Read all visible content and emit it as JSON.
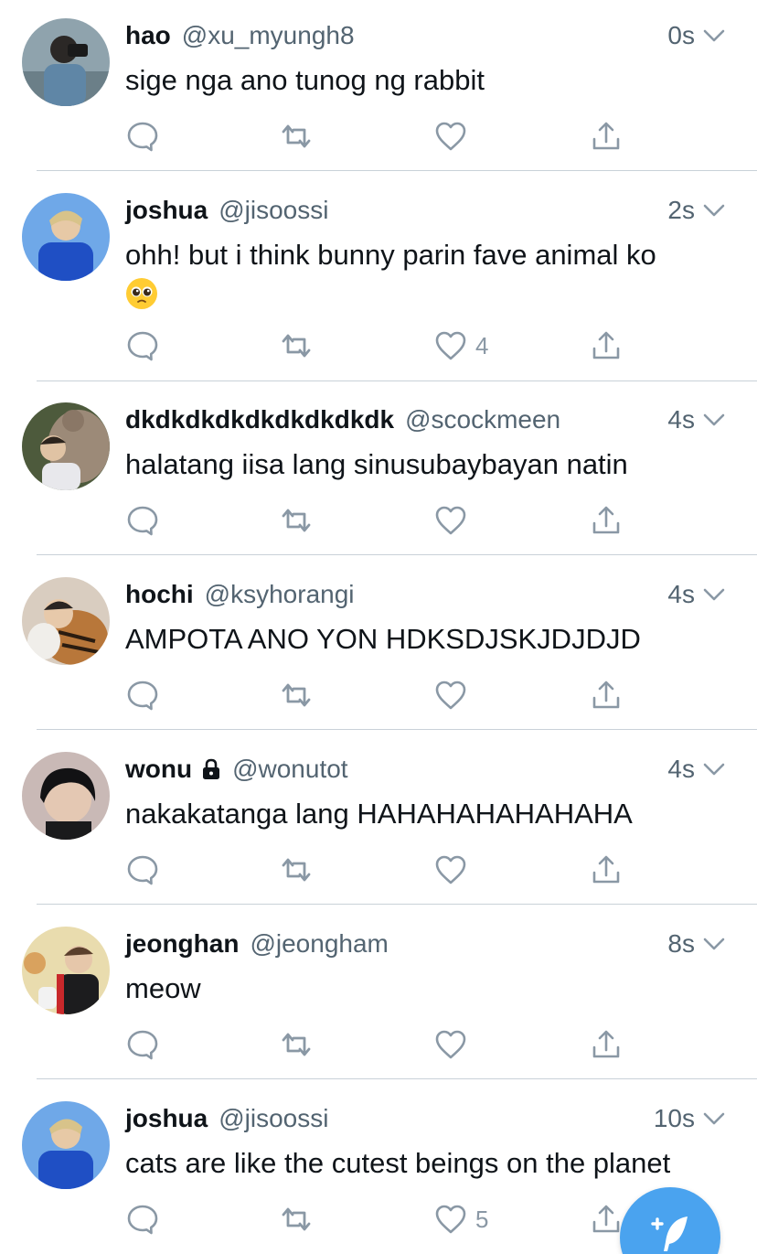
{
  "colors": {
    "accent": "#4aa3ef",
    "text": "#0f1419",
    "secondary": "#536471",
    "icon": "#8a98a5",
    "divider": "#c9d1d8"
  },
  "icons": {
    "reply": "reply-icon",
    "retweet": "retweet-icon",
    "like": "heart-icon",
    "share": "share-icon",
    "more": "chevron-down-icon",
    "compose": "compose-tweet-icon"
  },
  "tweets": [
    {
      "name": "hao",
      "handle": "@xu_myungh8",
      "time": "0s",
      "text": "sige nga ano tunog ng rabbit",
      "likes": ""
    },
    {
      "name": "joshua",
      "handle": "@jisoossi",
      "time": "2s",
      "text": "ohh! but i think bunny parin fave animal ko",
      "likes": "4"
    },
    {
      "name": "dkdkdkdkdkdkdkdkdk",
      "handle": "@scockmeen",
      "time": "4s",
      "text": "halatang iisa lang sinusubaybayan natin",
      "likes": ""
    },
    {
      "name": "hochi",
      "handle": "@ksyhorangi",
      "time": "4s",
      "text": "AMPOTA ANO YON HDKSDJSKJDJDJD",
      "likes": ""
    },
    {
      "name": "wonu",
      "handle": "@wonutot",
      "time": "4s",
      "text": "nakakatanga lang HAHAHAHAHAHAHA",
      "likes": ""
    },
    {
      "name": "jeonghan",
      "handle": "@jeongham",
      "time": "8s",
      "text": "meow",
      "likes": ""
    },
    {
      "name": "joshua",
      "handle": "@jisoossi",
      "time": "10s",
      "text": "cats are like the cutest beings on the planet",
      "likes": "5"
    }
  ]
}
